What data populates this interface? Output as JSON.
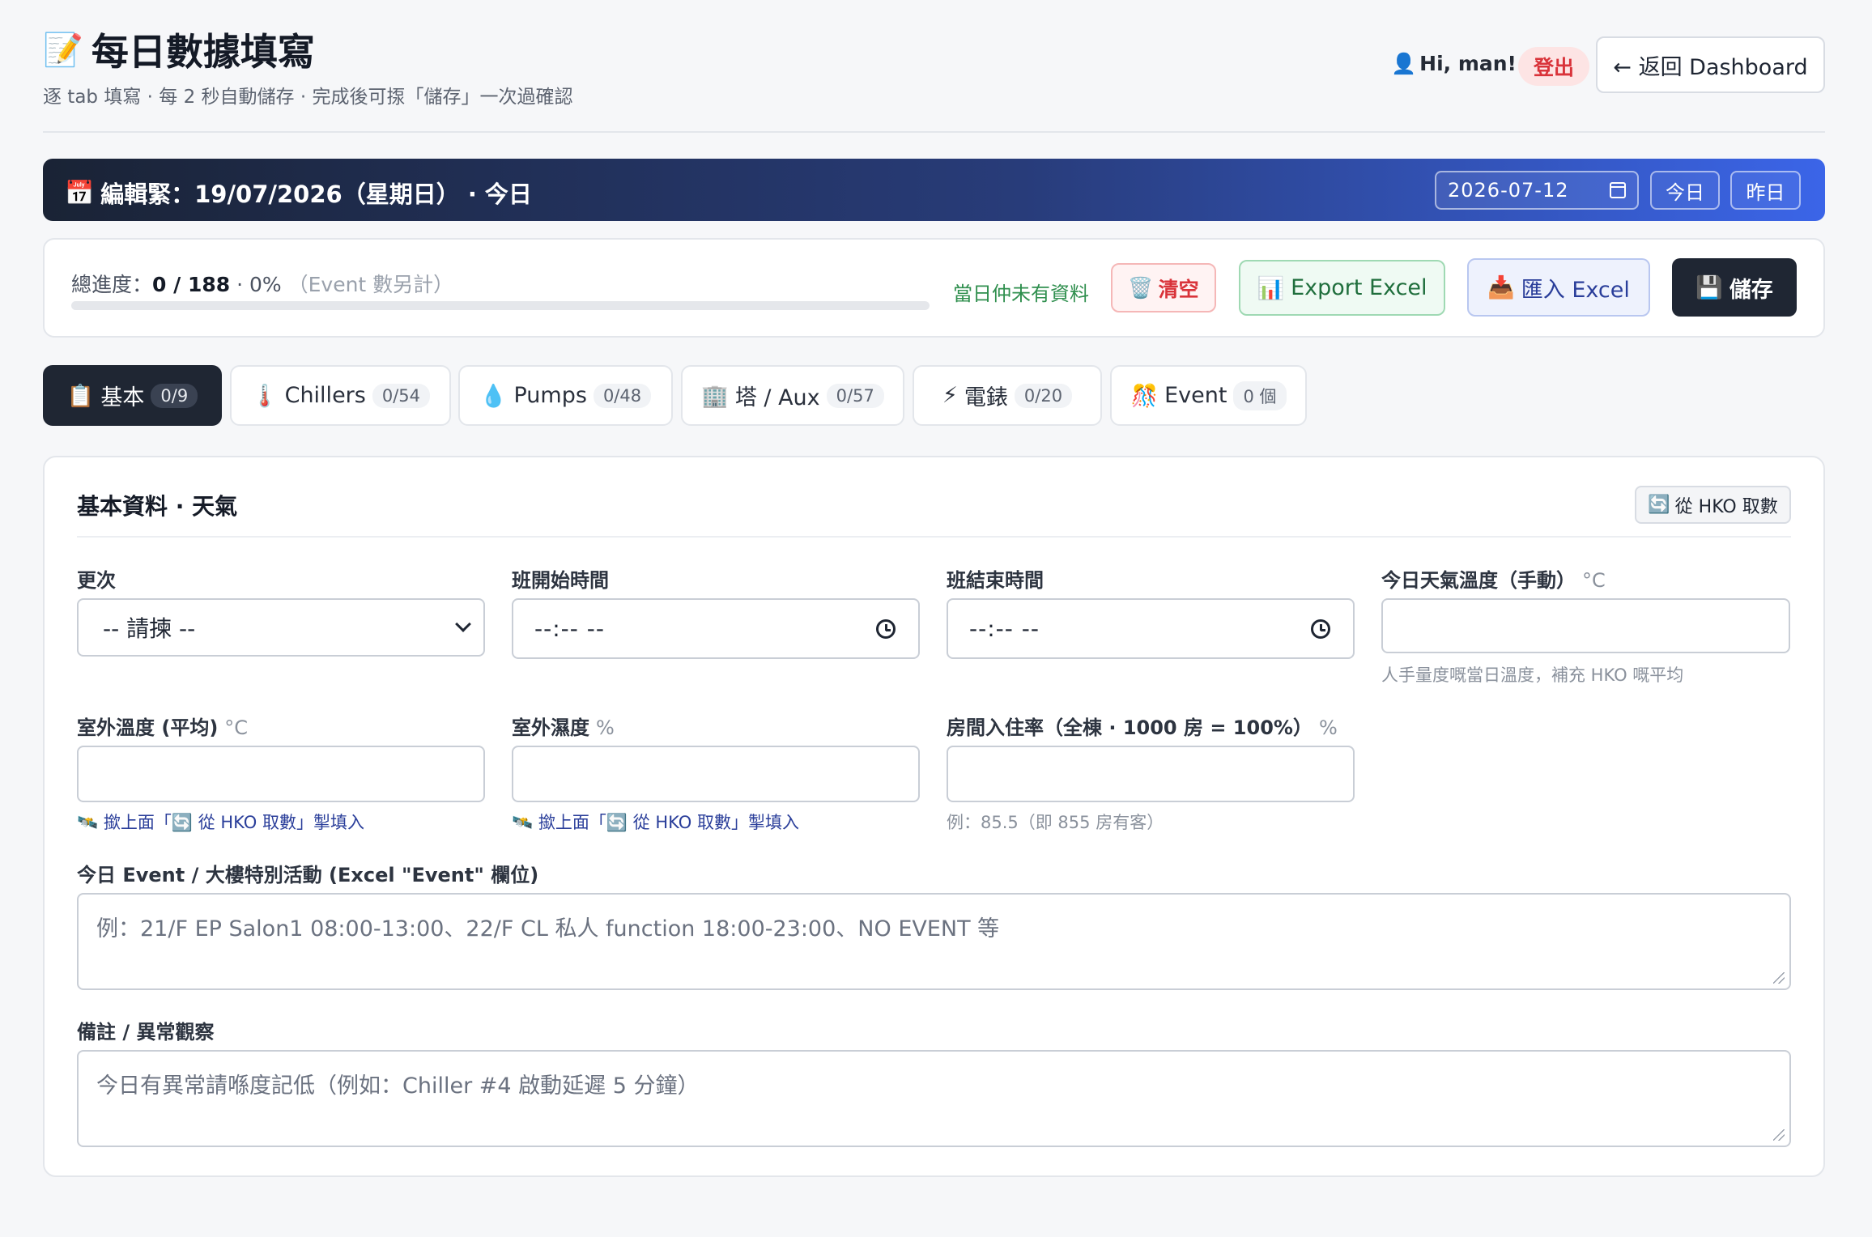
{
  "header": {
    "title_icon": "📝",
    "title": "每日數據填寫",
    "subtitle": "逐 tab 填寫 · 每 2 秒自動儲存 · 完成後可揼「儲存」一次過確認",
    "user_icon": "👤",
    "greeting": "Hi, man!",
    "logout_label": "登出",
    "back_label": "← 返回 Dashboard"
  },
  "banner": {
    "icon": "📅",
    "editing_label": "編輯緊：19/07/2026（星期日） · 今日",
    "date_value": "2026-07-12",
    "today_label": "今日",
    "yesterday_label": "昨日"
  },
  "progress": {
    "prefix": "總進度：",
    "count": "0 / 188",
    "percent_text": " · 0%",
    "note": "（Event 數另計）",
    "fraction": 0,
    "status_text": "當日仲未有資料",
    "clear_icon": "🗑️",
    "clear_label": "清空",
    "export_icon": "📊",
    "export_label": "Export Excel",
    "import_icon": "📥",
    "import_label": "匯入 Excel",
    "save_icon": "💾",
    "save_label": "儲存"
  },
  "tabs": [
    {
      "icon": "📋",
      "label": "基本",
      "count": "0/9",
      "active": true
    },
    {
      "icon": "🌡️",
      "label": "Chillers",
      "count": "0/54"
    },
    {
      "icon": "💧",
      "label": "Pumps",
      "count": "0/48"
    },
    {
      "icon": "🏢",
      "label": "塔 / Aux",
      "count": "0/57"
    },
    {
      "icon": "⚡",
      "label": "電錶",
      "count": "0/20"
    },
    {
      "icon": "🎊",
      "label": "Event",
      "count": "0 個"
    }
  ],
  "section": {
    "title": "基本資料 · 天氣",
    "hko_icon": "🔄",
    "hko_label": "從 HKO 取數"
  },
  "fields": {
    "shift_label": "更次",
    "shift_value": "-- 請揀 --",
    "start_label": "班開始時間",
    "start_value": "--:-- --",
    "end_label": "班結束時間",
    "end_value": "--:-- --",
    "manual_temp_label": "今日天氣溫度（手動）",
    "manual_temp_unit": "°C",
    "manual_temp_hint": "人手量度嘅當日溫度，補充 HKO 嘅平均",
    "outdoor_temp_label": "室外溫度 (平均)",
    "outdoor_temp_unit": "°C",
    "outdoor_temp_hint": "🛰️ 撳上面「🔄 從 HKO 取數」掣填入",
    "humidity_label": "室外濕度",
    "humidity_unit": "%",
    "humidity_hint": "🛰️ 撳上面「🔄 從 HKO 取數」掣填入",
    "occupancy_label": "房間入住率（全棟 · 1000 房 = 100%）",
    "occupancy_unit": "%",
    "occupancy_hint": "例：85.5（即 855 房有客）",
    "event_label": "今日 Event / 大樓特別活動 (Excel \"Event\" 欄位)",
    "event_placeholder": "例：21/F EP Salon1 08:00-13:00、22/F CL 私人 function 18:00-23:00、NO EVENT 等",
    "notes_label": "備註 / 異常觀察",
    "notes_placeholder": "今日有異常請喺度記低（例如：Chiller #4 啟動延遲 5 分鐘）"
  }
}
